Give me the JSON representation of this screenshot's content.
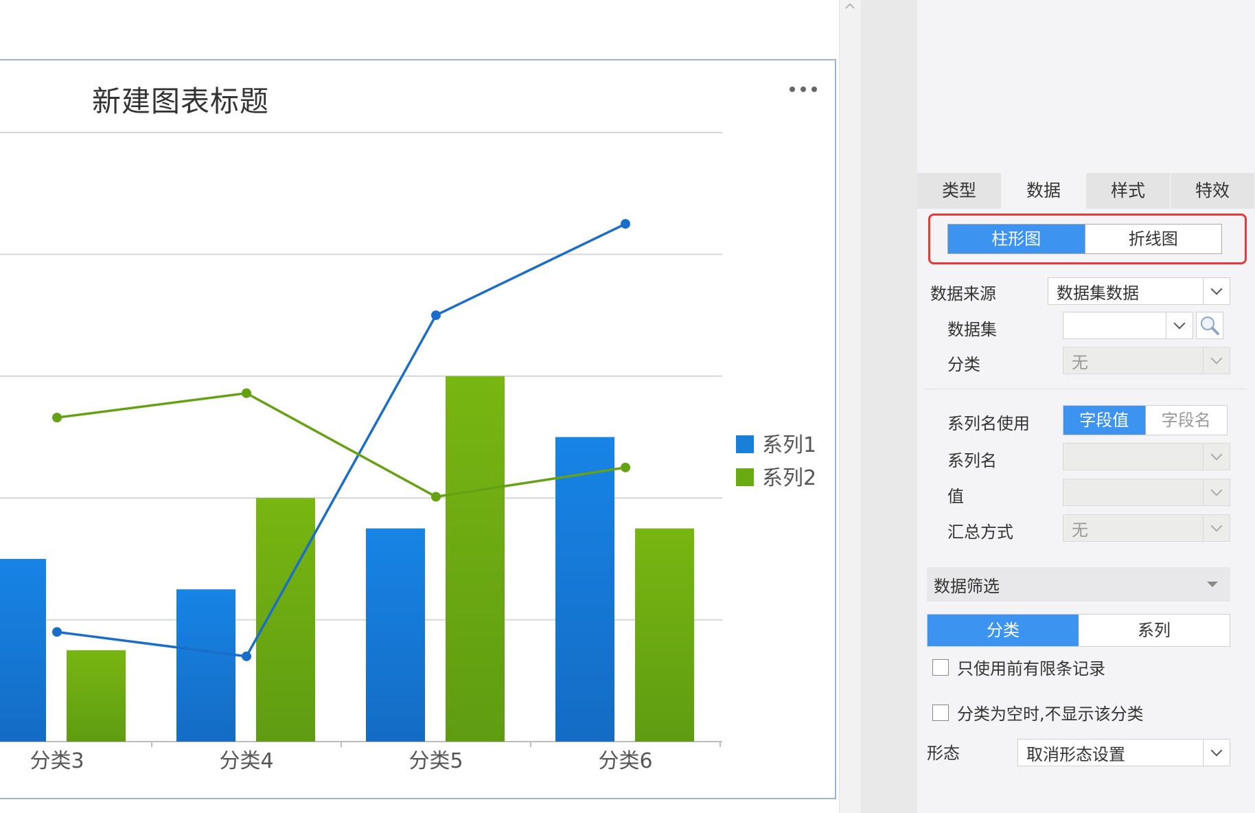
{
  "chart": {
    "title": "新建图表标题",
    "menu_icon": "more-horizontal-icon"
  },
  "chart_data": {
    "type": "bar",
    "subtype": "bar-line-combo",
    "categories": [
      "分类3",
      "分类4",
      "分类5",
      "分类6"
    ],
    "series": [
      {
        "name": "系列1",
        "type": "bar",
        "color": "#1a7fd6",
        "values": [
          150,
          125,
          175,
          250
        ]
      },
      {
        "name": "系列2",
        "type": "bar",
        "color": "#6aaa13",
        "values": [
          75,
          200,
          300,
          175
        ]
      },
      {
        "name": "系列1",
        "type": "line",
        "color": "#1a6ec9",
        "values": [
          90,
          70,
          350,
          425
        ]
      },
      {
        "name": "系列2",
        "type": "line",
        "color": "#66a113",
        "values": [
          266,
          286,
          201,
          225
        ]
      }
    ],
    "ylim": [
      0,
      500
    ],
    "grid": true,
    "legend": {
      "position": "right",
      "items": [
        {
          "label": "系列1",
          "color": "#1a7fd6"
        },
        {
          "label": "系列2",
          "color": "#6aaa13"
        }
      ]
    }
  },
  "scrollbar": {
    "up_icon": "chevron-up-icon"
  },
  "panel": {
    "tabs": [
      {
        "label": "类型",
        "active": false
      },
      {
        "label": "数据",
        "active": true
      },
      {
        "label": "样式",
        "active": false
      },
      {
        "label": "特效",
        "active": false
      }
    ],
    "chart_type_toggle": {
      "options": [
        "柱形图",
        "折线图"
      ],
      "selected": "柱形图"
    },
    "data_source": {
      "label": "数据来源",
      "value": "数据集数据"
    },
    "dataset": {
      "label": "数据集",
      "value": "",
      "search_icon": "search-icon"
    },
    "category": {
      "label": "分类",
      "value": "无"
    },
    "series_name_use": {
      "label": "系列名使用",
      "options": [
        "字段值",
        "字段名"
      ],
      "selected": "字段值"
    },
    "series_name": {
      "label": "系列名",
      "value": ""
    },
    "value": {
      "label": "值",
      "value": ""
    },
    "aggregate": {
      "label": "汇总方式",
      "value": "无"
    },
    "data_filter": {
      "label": "数据筛选",
      "tabs": [
        "分类",
        "系列"
      ],
      "selected": "分类"
    },
    "checkbox_limit": {
      "label": "只使用前有限条记录",
      "checked": false
    },
    "checkbox_empty": {
      "label": "分类为空时,不显示该分类",
      "checked": false
    },
    "shape": {
      "label": "形态",
      "value": "取消形态设置"
    }
  }
}
